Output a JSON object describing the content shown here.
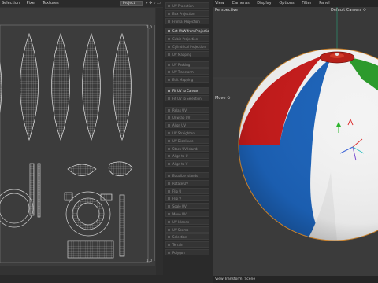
{
  "uv_editor": {
    "menu": [
      "Selection",
      "Pixel",
      "Textures"
    ],
    "mode_select": "Project",
    "nav_icons": "▸ ✥ ⌕ ▭",
    "corner_top": "1,0",
    "corner_bottom": "1,0",
    "background_color": "#3c3c3c",
    "mesh_color": "#d8d8d8"
  },
  "tool_panel": {
    "items": [
      {
        "label": "UV Projection",
        "active": false
      },
      {
        "label": "Box Projection",
        "active": false
      },
      {
        "label": "Frontal Projection",
        "active": false
      },
      {
        "label": "Set UVW from Projection",
        "active": true
      },
      {
        "label": "Cubic Projection",
        "active": false
      },
      {
        "label": "Cylindrical Projection",
        "active": false
      },
      {
        "label": "UV Mapping",
        "active": false
      },
      {
        "label": "UV Packing",
        "active": false
      },
      {
        "label": "UV Transform",
        "active": false
      },
      {
        "label": "Edit Mapping",
        "active": false
      },
      {
        "label": "Fit UV to Canvas",
        "active": true
      },
      {
        "label": "Fit UV to Selection",
        "active": false
      },
      {
        "label": "Relax UV",
        "active": false
      },
      {
        "label": "Unwrap UV",
        "active": false
      },
      {
        "label": "Align UV",
        "active": false
      },
      {
        "label": "UV Straighten",
        "active": false
      },
      {
        "label": "UV Distribute",
        "active": false
      },
      {
        "label": "Stack UV Islands",
        "active": false
      },
      {
        "label": "Align to U",
        "active": false
      },
      {
        "label": "Align to V",
        "active": false
      },
      {
        "label": "Equalize Islands",
        "active": false
      },
      {
        "label": "Rotate UV",
        "active": false
      },
      {
        "label": "Flip U",
        "active": false
      },
      {
        "label": "Flip V",
        "active": false
      },
      {
        "label": "Scale UV",
        "active": false
      },
      {
        "label": "Move UV",
        "active": false
      },
      {
        "label": "UV Islands",
        "active": false
      },
      {
        "label": "UV Seams",
        "active": false
      },
      {
        "label": "Selection",
        "active": false
      },
      {
        "label": "Terrain",
        "active": false
      },
      {
        "label": "Polygon",
        "active": false
      }
    ]
  },
  "viewport": {
    "menu": [
      "View",
      "Cameras",
      "Display",
      "Options",
      "Filter",
      "Panel"
    ],
    "mode_label": "Perspective",
    "camera_label": "Default Camera ⟳",
    "move_label": "Move ⟲",
    "footer": "View Transform: Scene",
    "ball_colors": {
      "red": "#c61b1b",
      "blue": "#1c62b8",
      "green": "#2a9a2a",
      "yellow": "#e0b60f",
      "white": "#f3f3f3"
    }
  }
}
